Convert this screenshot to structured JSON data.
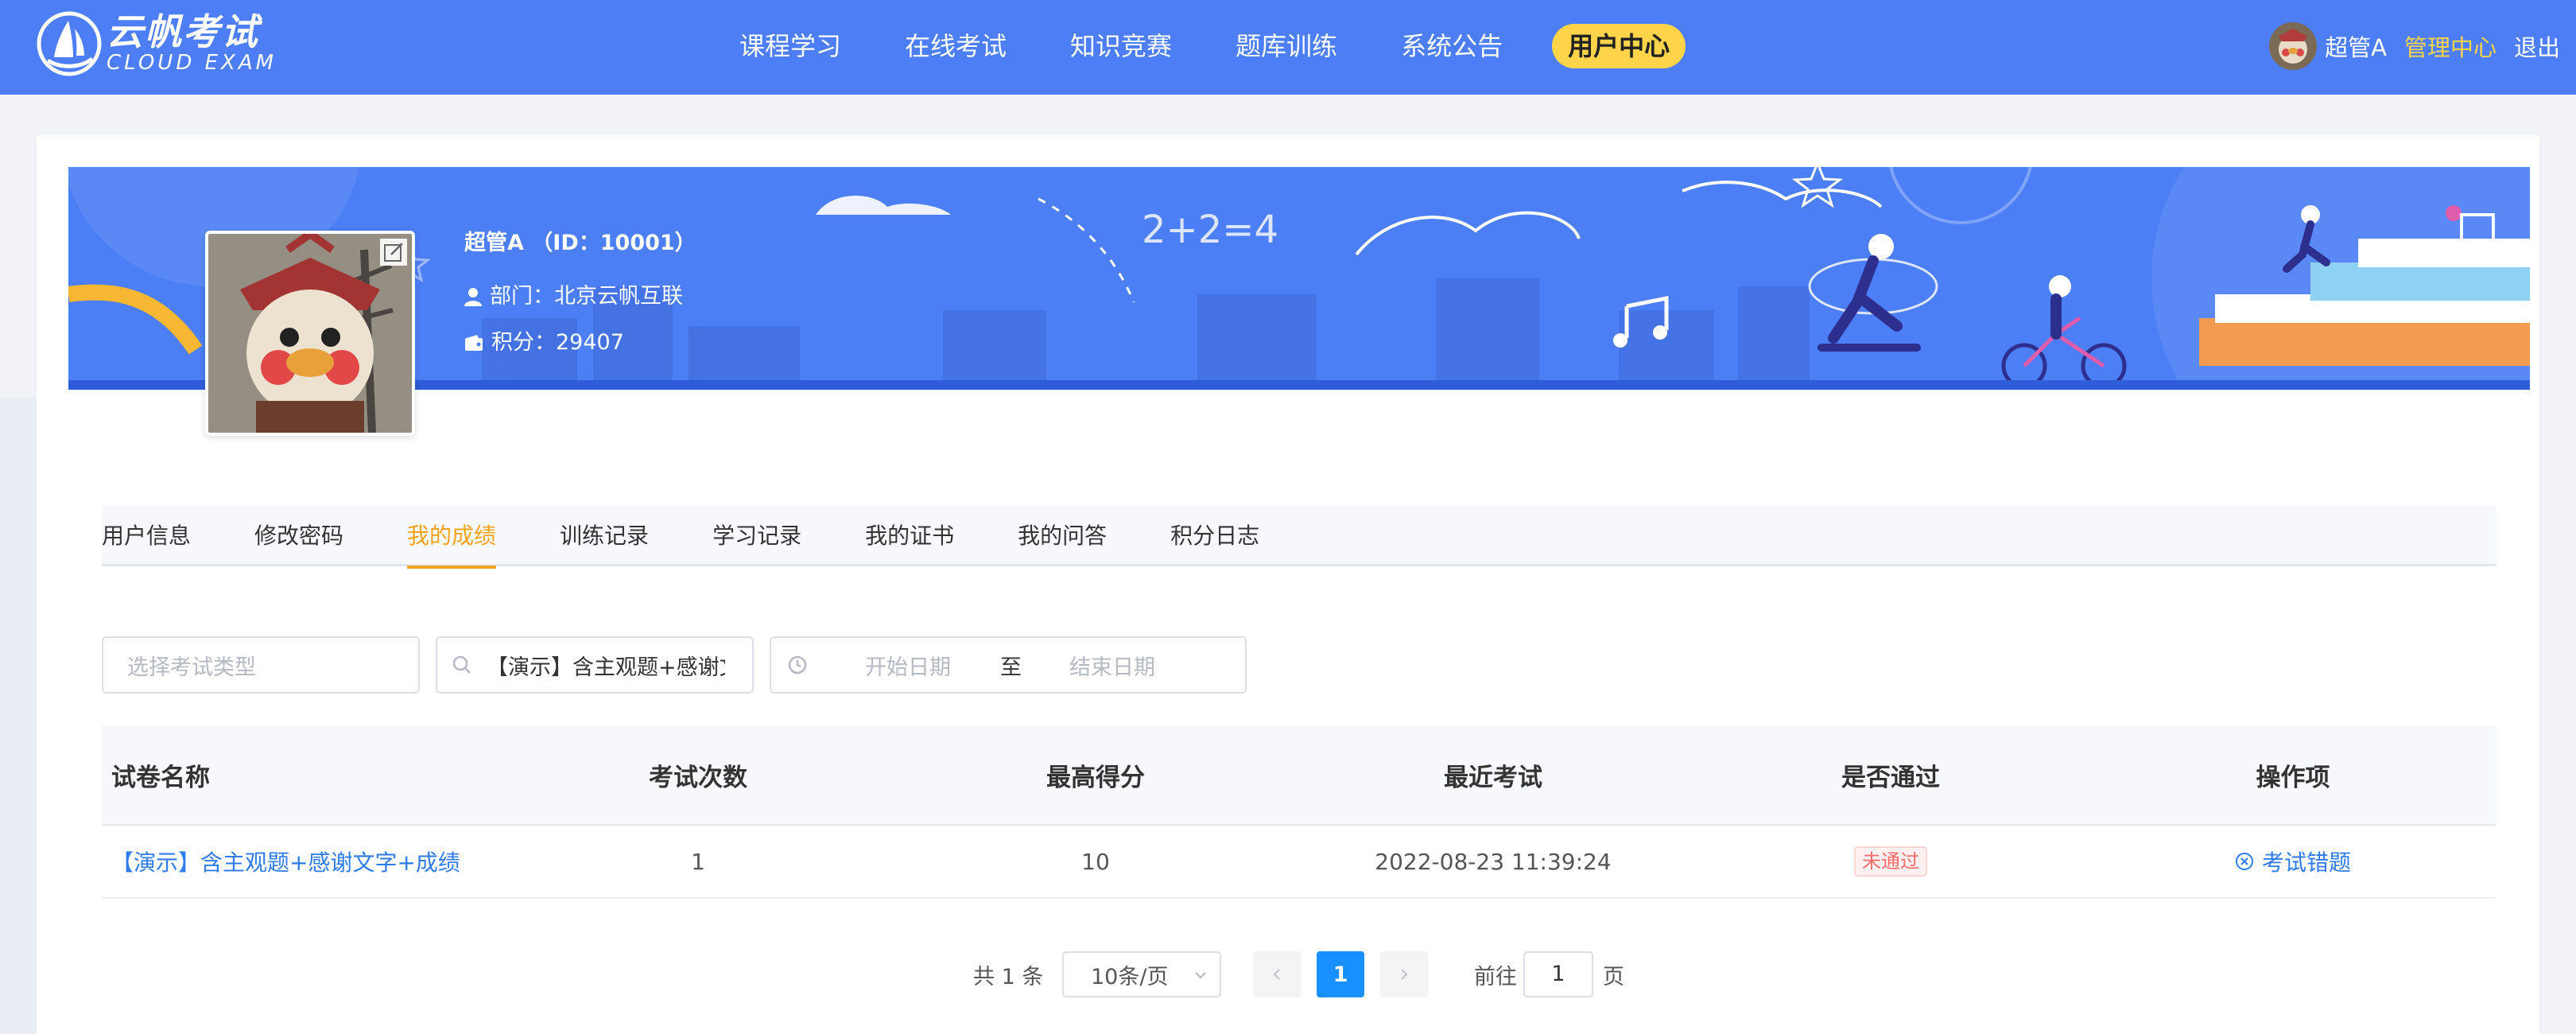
{
  "brand": {
    "name_cn": "云帆考试",
    "name_en": "CLOUD EXAM"
  },
  "nav": {
    "items": [
      {
        "label": "课程学习"
      },
      {
        "label": "在线考试"
      },
      {
        "label": "知识竞赛"
      },
      {
        "label": "题库训练"
      },
      {
        "label": "系统公告"
      },
      {
        "label": "用户中心",
        "active": true
      }
    ]
  },
  "user": {
    "name": "超管A",
    "admin_label": "管理中心",
    "logout_label": "退出"
  },
  "profile": {
    "name_line": "超管A （ID：10001）",
    "dept_line": "部门：北京云帆互联",
    "points_line": "积分：29407"
  },
  "tabs": [
    {
      "label": "用户信息"
    },
    {
      "label": "修改密码"
    },
    {
      "label": "我的成绩",
      "active": true
    },
    {
      "label": "训练记录"
    },
    {
      "label": "学习记录"
    },
    {
      "label": "我的证书"
    },
    {
      "label": "我的问答"
    },
    {
      "label": "积分日志"
    }
  ],
  "filters": {
    "exam_type_placeholder": "选择考试类型",
    "search_value": "【演示】含主观题+感谢文字+成绩",
    "start_date_placeholder": "开始日期",
    "date_separator": "至",
    "end_date_placeholder": "结束日期"
  },
  "table": {
    "headers": [
      "试卷名称",
      "考试次数",
      "最高得分",
      "最近考试",
      "是否通过",
      "操作项"
    ],
    "rows": [
      {
        "name": "【演示】含主观题+感谢文字+成绩",
        "count": "1",
        "max_score": "10",
        "last_exam": "2022-08-23 11:39:24",
        "passed": "未通过",
        "action": "考试错题"
      }
    ]
  },
  "pagination": {
    "total": "共 1 条",
    "page_size": "10条/页",
    "current_page": "1",
    "goto_label": "前往",
    "goto_value": "1",
    "goto_unit": "页"
  },
  "colors": {
    "header_bg": "#4d7ef6",
    "active_nav": "#ffd34a",
    "active_tab": "#f4a31f",
    "link": "#2f7be8",
    "page_active": "#1890ff",
    "fail": "#f56c6c"
  }
}
